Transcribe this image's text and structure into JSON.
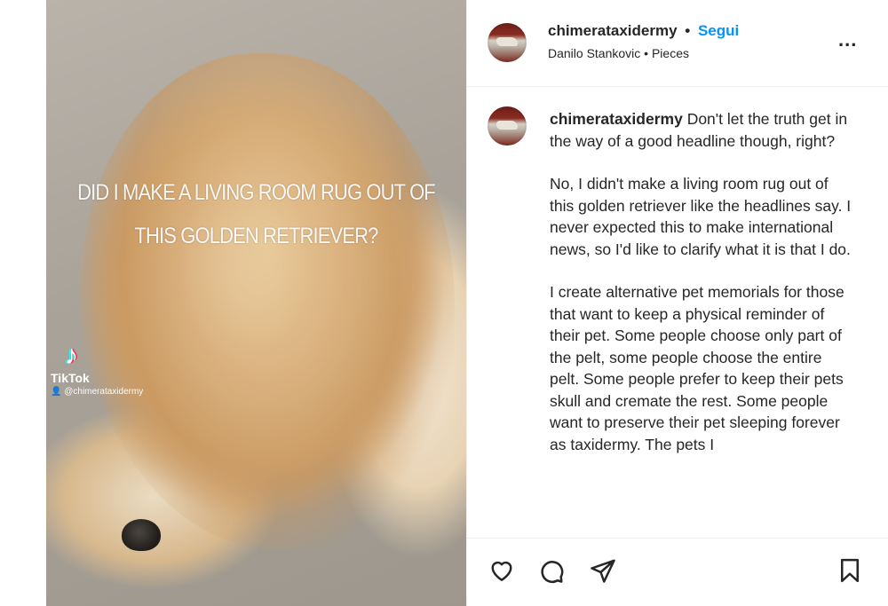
{
  "media": {
    "overlay_line1": "DID I MAKE A LIVING ROOM RUG OUT OF",
    "overlay_line2": "THIS GOLDEN RETRIEVER?",
    "tiktok_brand": "TikTok",
    "tiktok_handle": "@chimerataxidermy"
  },
  "header": {
    "username": "chimerataxidermy",
    "separator": "•",
    "follow_label": "Segui",
    "subtitle": "Danilo Stankovic • Pieces",
    "more_label": "..."
  },
  "caption": {
    "username": "chimerataxidermy",
    "paragraph1": "Don't let the truth get in the way of a good headline though, right?",
    "paragraph2": "No, I didn't make a living room rug out of this golden retriever like the headlines say. I never expected this to make international news, so I'd like to clarify what it is that I do.",
    "paragraph3": "I create alternative pet memorials for those that want to keep a physical reminder of their pet. Some people choose only part of the pelt, some people choose the entire pelt. Some people prefer to keep their pets skull and cremate the rest. Some people want to preserve their pet sleeping forever as taxidermy. The pets I"
  },
  "actions": {
    "icons": [
      "heart-icon",
      "comment-icon",
      "share-icon",
      "bookmark-icon"
    ]
  }
}
